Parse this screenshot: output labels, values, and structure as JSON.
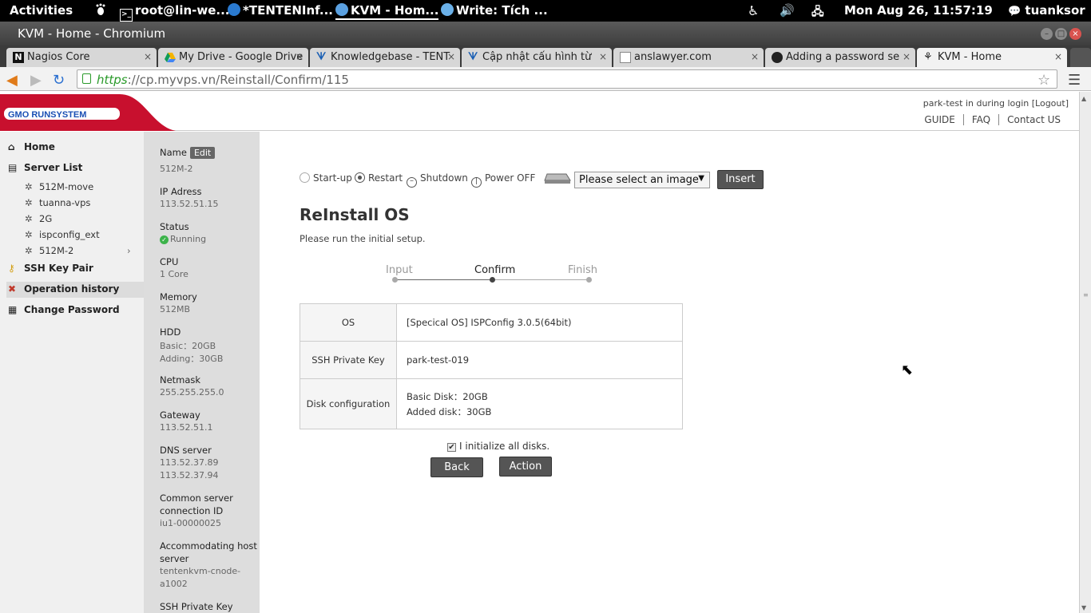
{
  "gnome": {
    "activities": "Activities",
    "windows": [
      "root@lin-we...",
      "*TENTENInf...",
      "KVM - Hom...",
      "Write: Tích ..."
    ],
    "clock": "Mon Aug 26, 11:57:19",
    "user": "tuanksor"
  },
  "window": {
    "title": "KVM - Home - Chromium"
  },
  "tabs": [
    "Nagios Core",
    "My Drive - Google Drive",
    "Knowledgebase - TENT",
    "Cập nhật cấu hình từ",
    "anslawyer.com",
    "Adding a password se",
    "KVM - Home"
  ],
  "address": {
    "https": "https",
    "rest": "://cp.myvps.vn/Reinstall/Confirm/115"
  },
  "header": {
    "logo": "GMO RUNSYSTEM",
    "login": "park-test in during login [Logout]",
    "nav": [
      "GUIDE",
      "FAQ",
      "Contact US"
    ]
  },
  "sidebar": {
    "home": "Home",
    "server_list": "Server List",
    "servers": [
      "512M-move",
      "tuanna-vps",
      "2G",
      "ispconfig_ext",
      "512M-2"
    ],
    "ssh_key": "SSH Key Pair",
    "op_history": "Operation history",
    "change_pw": "Change Password"
  },
  "info": {
    "name_label": "Name",
    "edit": "Edit",
    "name": "512M-2",
    "ip_label": "IP Adress",
    "ip": "113.52.51.15",
    "status_label": "Status",
    "status": "Running",
    "cpu_label": "CPU",
    "cpu": "1 Core",
    "mem_label": "Memory",
    "mem": "512MB",
    "hdd_label": "HDD",
    "hdd_basic": "Basic：20GB",
    "hdd_add": "Adding：30GB",
    "netmask_label": "Netmask",
    "netmask": "255.255.255.0",
    "gateway_label": "Gateway",
    "gateway": "113.52.51.1",
    "dns_label": "DNS server",
    "dns1": "113.52.37.89",
    "dns2": "113.52.37.94",
    "conn_label1": "Common server",
    "conn_label2": "connection ID",
    "conn": "iu1-00000025",
    "host_label1": "Accommodating host",
    "host_label2": "server",
    "host1": "tentenkvm-cnode-",
    "host2": "a1002",
    "sshkey_label": "SSH Private Key"
  },
  "power": {
    "startup": "Start-up",
    "restart": "Restart",
    "shutdown": "Shutdown",
    "poweroff": "Power OFF",
    "select": "Please select an image",
    "insert": "Insert"
  },
  "main": {
    "title": "ReInstall OS",
    "intro": "Please run the initial setup.",
    "steps": [
      "Input",
      "Confirm",
      "Finish"
    ],
    "rows": [
      {
        "k": "OS",
        "v": "[Specical OS] ISPConfig 3.0.5(64bit)"
      },
      {
        "k": "SSH Private Key",
        "v": "park-test-019"
      },
      {
        "k": "Disk configuration",
        "v1": "Basic Disk：20GB",
        "v2": "Added disk：30GB"
      }
    ],
    "checkbox": "I initialize all disks.",
    "back": "Back",
    "action": "Action"
  }
}
